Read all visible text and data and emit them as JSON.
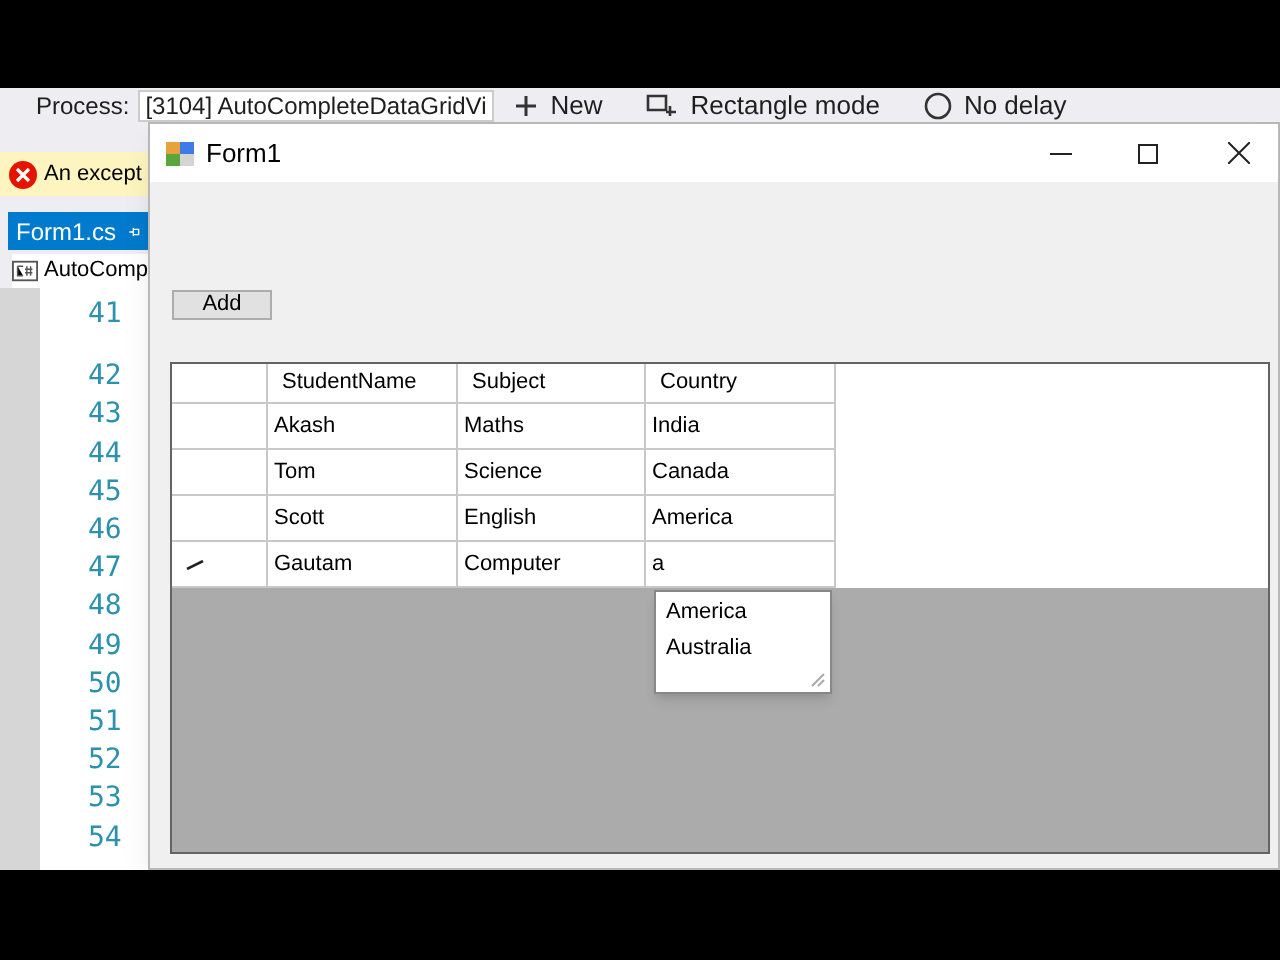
{
  "ide": {
    "process_label": "Process:",
    "process_value": "[3104] AutoCompleteDataGridVi",
    "toolbar": [
      {
        "kind": "plus",
        "label": "New"
      },
      {
        "kind": "rect",
        "label": "Rectangle mode"
      },
      {
        "kind": "clock",
        "label": "No delay"
      }
    ],
    "error_text": "An except",
    "tab": "Form1.cs",
    "class_item": "AutoComp",
    "line_numbers": [
      "41",
      "42",
      "43",
      "44",
      "45",
      "46",
      "47",
      "48",
      "49",
      "50",
      "51",
      "52",
      "53",
      "54"
    ]
  },
  "window": {
    "title": "Form1",
    "add_button": "Add",
    "grid": {
      "columns": [
        "StudentName",
        "Subject",
        "Country"
      ],
      "rows": [
        {
          "editing": false,
          "cells": [
            "Akash",
            "Maths",
            "India"
          ]
        },
        {
          "editing": false,
          "cells": [
            "Tom",
            "Science",
            "Canada"
          ]
        },
        {
          "editing": false,
          "cells": [
            "Scott",
            "English",
            "America"
          ]
        },
        {
          "editing": true,
          "cells": [
            "Gautam",
            "Computer",
            "a"
          ]
        }
      ],
      "suggestions": [
        "America",
        "Australia"
      ]
    }
  }
}
